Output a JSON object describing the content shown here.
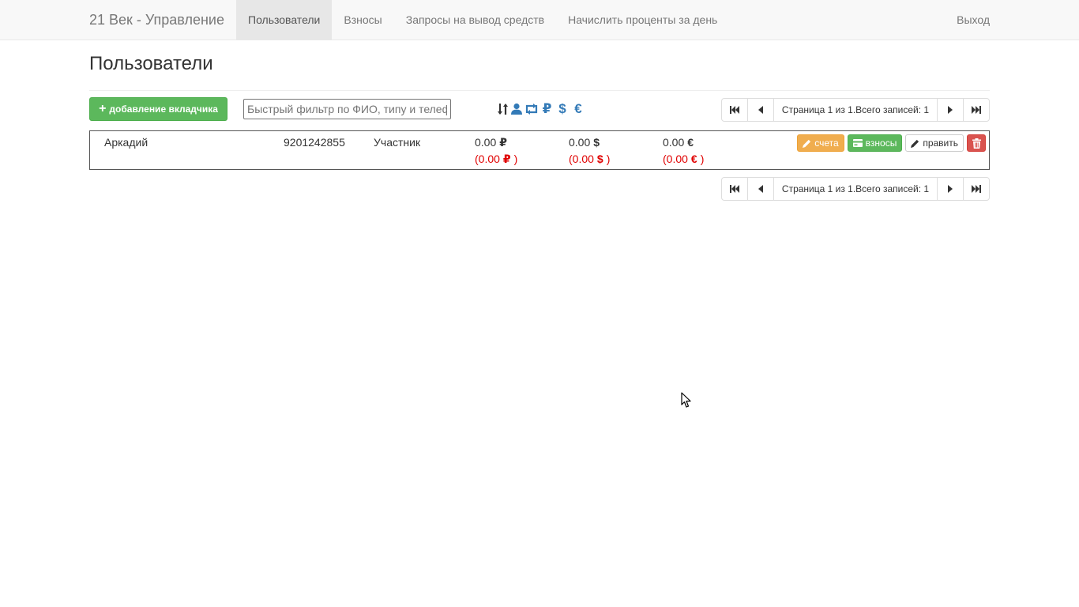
{
  "navbar": {
    "brand": "21 Век - Управление",
    "items": [
      {
        "label": "Пользователи",
        "active": true
      },
      {
        "label": "Взносы",
        "active": false
      },
      {
        "label": "Запросы на вывод средств",
        "active": false
      },
      {
        "label": "Начислить проценты за день",
        "active": false
      }
    ],
    "logout": "Выход"
  },
  "page": {
    "title": "Пользователи"
  },
  "toolbar": {
    "add_button": "добавление вкладчика",
    "filter_placeholder": "Быстрый фильтр по ФИО, типу и телефону",
    "filter_value": "",
    "sort_icons": [
      "sort-icon",
      "user-icon",
      "retweet-icon",
      "ruble-icon",
      "dollar-icon",
      "euro-icon"
    ],
    "currency_symbols": {
      "rub": "₽",
      "usd": "$",
      "eur": "€"
    }
  },
  "pagination": {
    "info": "Страница 1 из 1.Всего записей: 1"
  },
  "users": [
    {
      "name": "Аркадий",
      "phone": "9201242855",
      "type": "Участник",
      "balances": [
        {
          "amount": "0.00",
          "currency": "₽",
          "pending": "0.00"
        },
        {
          "amount": "0.00",
          "currency": "$",
          "pending": "0.00"
        },
        {
          "amount": "0.00",
          "currency": "€",
          "pending": "0.00"
        }
      ],
      "actions": {
        "accounts": "счета",
        "contributions": "взносы",
        "edit": "править"
      }
    }
  ],
  "colors": {
    "primary_link": "#337ab7",
    "success": "#5cb85c",
    "warning": "#f0ad4e",
    "danger": "#d9534f",
    "negative_text": "#e00000"
  }
}
